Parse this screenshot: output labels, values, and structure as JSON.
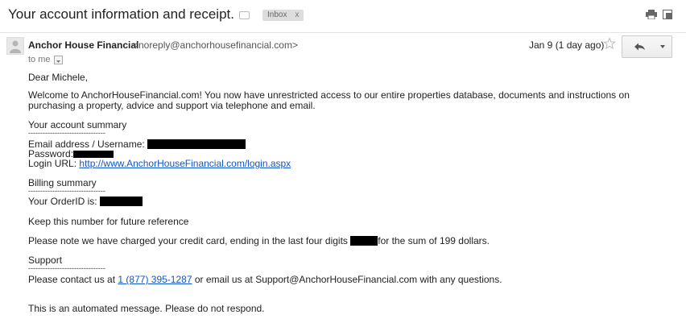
{
  "subject": "Your account information and receipt.",
  "label_chip": "Inbox",
  "label_chip_close": "x",
  "sender": {
    "name": "Anchor House Financial",
    "email": "<noreply@anchorhousefinancial.com>"
  },
  "recipient_label": "to me",
  "date": "Jan 9 (1 day ago)",
  "body": {
    "greeting": "Dear Michele,",
    "welcome": "Welcome to AnchorHouseFinancial.com!  You now have unrestricted access to our entire properties database, documents and instructions on purchasing a property, advice and support via telephone and email.",
    "account_summary_heading": "Your account summary",
    "divider": "--------------------------------",
    "email_label": "Email address / Username:",
    "password_label": "Password:",
    "login_label": "Login URL:",
    "login_url": "http://www.AnchorHouseFinancial.com/login.aspx",
    "billing_heading": "Billing summary",
    "order_label": "Your OrderID is:",
    "keep_note": "Keep this number for future reference",
    "charge_before": "Please note we have charged your credit card, ending in the last four digits",
    "charge_after": "for the sum of 199 dollars.",
    "support_heading": "Support",
    "contact_before": "Please contact us at",
    "phone": "1 (877) 395-1287",
    "contact_after": "or email us at Support@AnchorHouseFinancial.com with any questions.",
    "automated": "This is an automated message.  Please do not respond."
  },
  "colors": {
    "link": "#1155cc",
    "chip_bg": "#dddddd",
    "redaction": "#000000"
  }
}
